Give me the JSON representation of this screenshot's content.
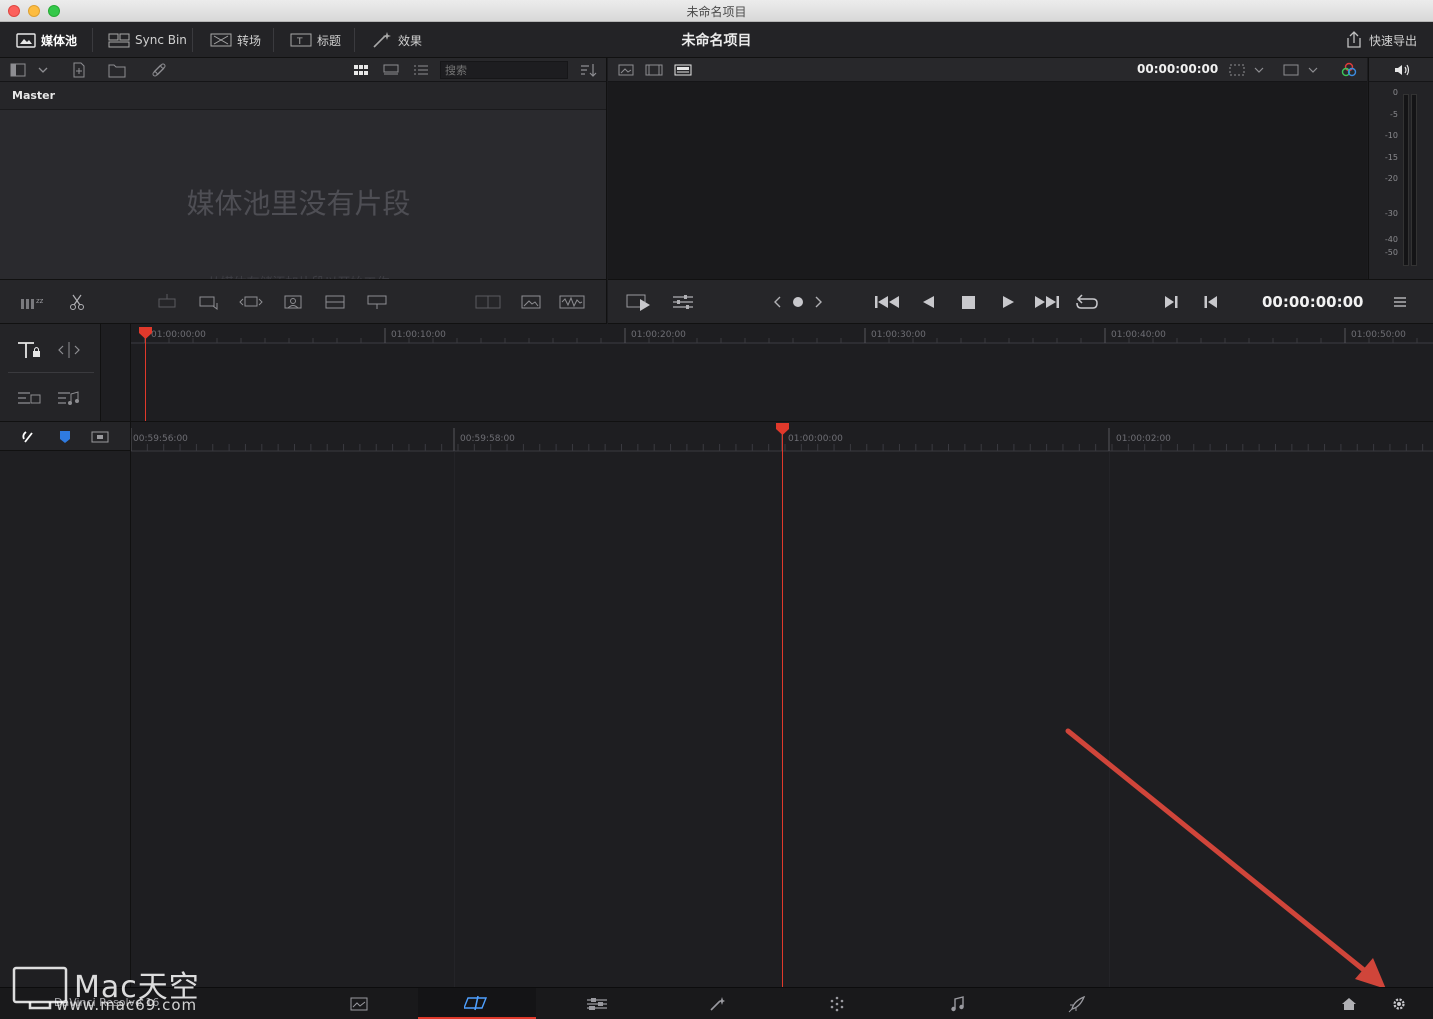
{
  "window": {
    "title": "未命名项目"
  },
  "toolbar": {
    "media_pool": "媒体池",
    "sync_bin": "Sync Bin",
    "transitions": "转场",
    "titles": "标题",
    "effects": "效果",
    "project_title": "未命名项目",
    "quick_export": "快速导出"
  },
  "media_pool": {
    "search_placeholder": "搜索",
    "bin_name": "Master",
    "empty_title": "媒体池里没有片段",
    "empty_subtitle": "从媒体存储添加片段以开始工作"
  },
  "viewer": {
    "timecode_top": "00:00:00:00",
    "timecode_main": "00:00:00:00"
  },
  "audio_meter": {
    "labels": [
      "0",
      "-5",
      "-10",
      "-15",
      "-20",
      "-30",
      "-40",
      "-50"
    ]
  },
  "upper_timeline": {
    "ticks": [
      "01:00:00:00",
      "01:00:10:00",
      "01:00:20:00",
      "01:00:30:00",
      "01:00:40:00",
      "01:00:50:00"
    ]
  },
  "lower_timeline": {
    "ticks": [
      "00:59:56:00",
      "00:59:58:00",
      "01:00:00:00",
      "01:00:02:00"
    ]
  },
  "bottom": {
    "app_name": "DaVinci Resolve 16",
    "watermark_brand": "Mac天空",
    "watermark_url": "www.mac69.com"
  },
  "colors": {
    "accent_red": "#e0392b",
    "active_page_blue": "#4fa0ff",
    "annotation_arrow": "#d0453a"
  }
}
